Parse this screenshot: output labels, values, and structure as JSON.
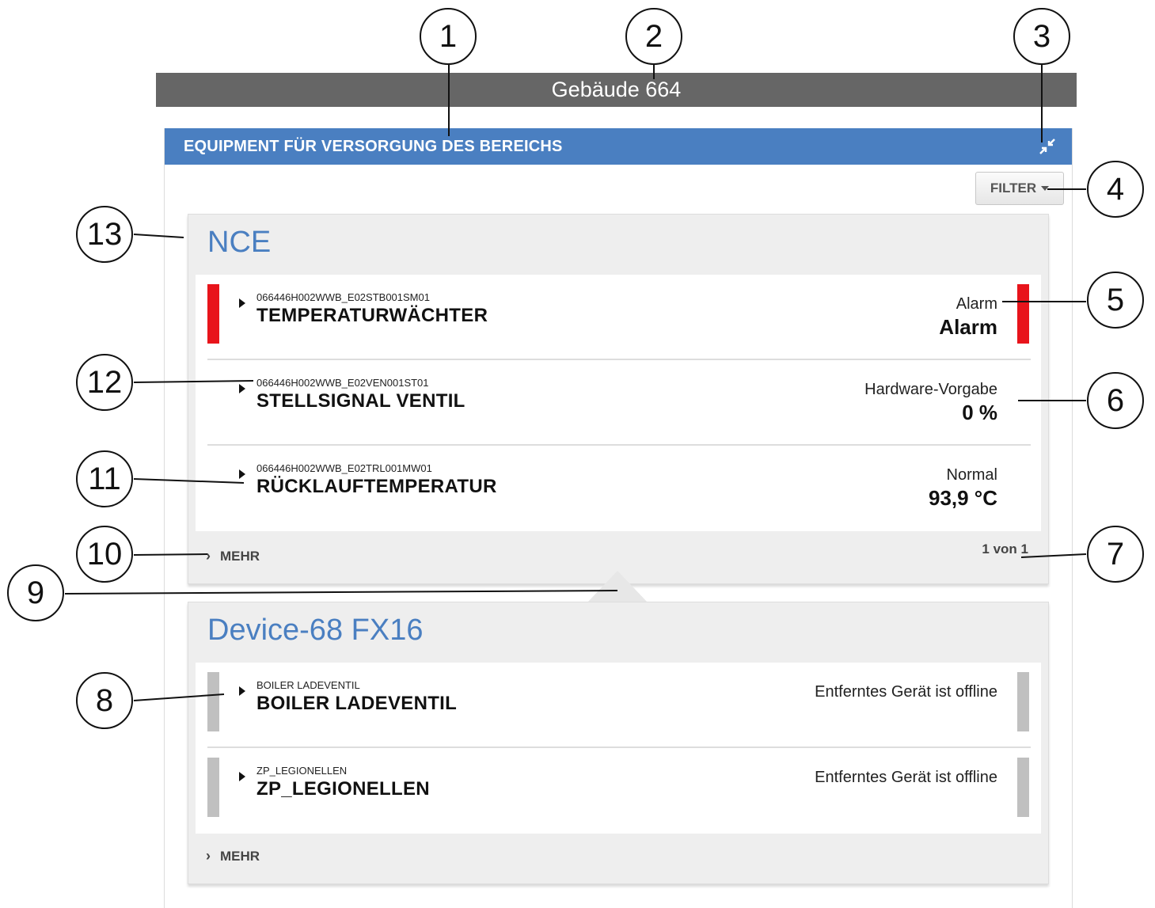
{
  "window": {
    "title": "Gebäude 664"
  },
  "panel": {
    "title": "EQUIPMENT FÜR VERSORGUNG DES BEREICHS",
    "collapse_icon": "collapse-arrows-icon",
    "filter_label": "FILTER"
  },
  "groups": [
    {
      "title": "NCE",
      "items": [
        {
          "id": "066446H002WWB_E02STB001SM01",
          "name": "TEMPERATURWÄCHTER",
          "status": "Alarm",
          "value": "Alarm",
          "stripe_color": "#e8141b"
        },
        {
          "id": "066446H002WWB_E02VEN001ST01",
          "name": "STELLSIGNAL VENTIL",
          "status": "Hardware-Vorgabe",
          "value": "0 %",
          "stripe_color": ""
        },
        {
          "id": "066446H002WWB_E02TRL001MW01",
          "name": "RÜCKLAUFTEMPERATUR",
          "status": "Normal",
          "value": "93,9 °C",
          "stripe_color": ""
        }
      ],
      "more_label": "MEHR",
      "pager": "1 von 1"
    },
    {
      "title": "Device-68 FX16",
      "items": [
        {
          "id": "BOILER LADEVENTIL",
          "name": "BOILER LADEVENTIL",
          "status": "Entferntes Gerät ist offline",
          "value": "",
          "stripe_color": "#c0c0c0"
        },
        {
          "id": "ZP_LEGIONELLEN",
          "name": "ZP_LEGIONELLEN",
          "status": "Entferntes Gerät ist offline",
          "value": "",
          "stripe_color": "#c0c0c0"
        }
      ],
      "more_label": "MEHR"
    }
  ],
  "callouts": [
    "1",
    "2",
    "3",
    "4",
    "5",
    "6",
    "7",
    "8",
    "9",
    "10",
    "11",
    "12",
    "13"
  ],
  "colors": {
    "accent": "#4a7fc1",
    "header_gray": "#666666",
    "alarm": "#e8141b",
    "offline": "#c0c0c0"
  }
}
